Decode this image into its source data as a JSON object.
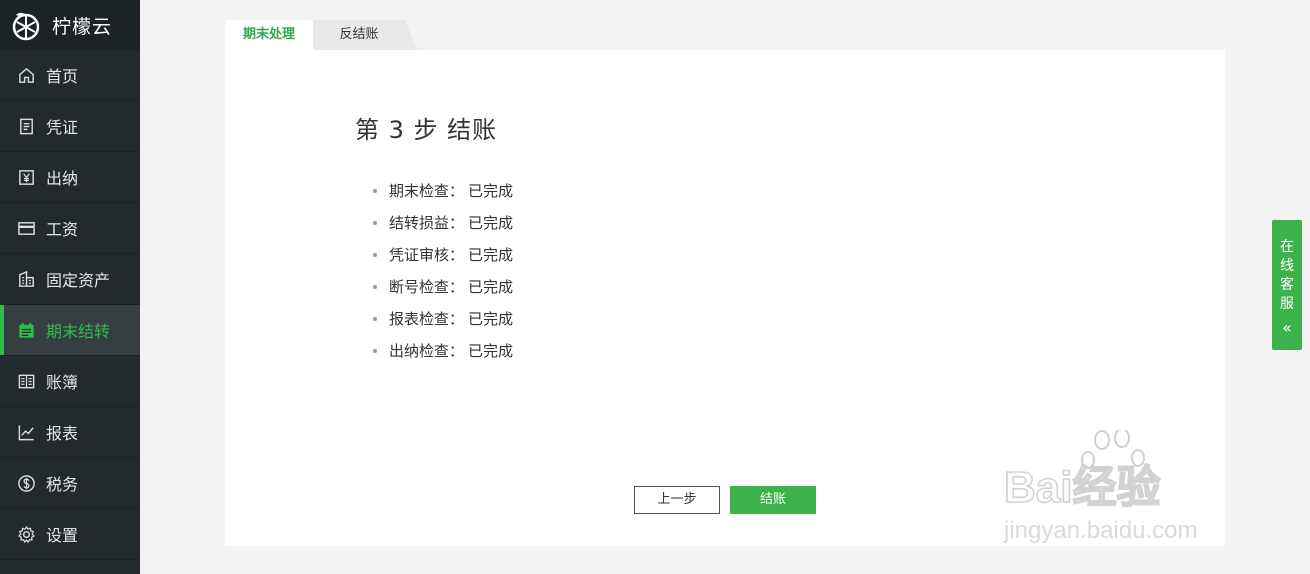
{
  "brand": {
    "name": "柠檬云",
    "logo": "lemon-slice-logo"
  },
  "sidebar": {
    "items": [
      {
        "label": "首页",
        "icon": "home-icon"
      },
      {
        "label": "凭证",
        "icon": "document-icon"
      },
      {
        "label": "出纳",
        "icon": "yen-icon"
      },
      {
        "label": "工资",
        "icon": "card-icon"
      },
      {
        "label": "固定资产",
        "icon": "building-icon"
      },
      {
        "label": "期末结转",
        "icon": "calendar-icon",
        "active": true
      },
      {
        "label": "账簿",
        "icon": "book-icon"
      },
      {
        "label": "报表",
        "icon": "chart-icon"
      },
      {
        "label": "税务",
        "icon": "dollar-icon"
      },
      {
        "label": "设置",
        "icon": "gear-icon"
      }
    ]
  },
  "tabs": [
    {
      "label": "期末处理",
      "active": true
    },
    {
      "label": "反结账",
      "active": false
    }
  ],
  "main": {
    "step_title": "第 3 步 结账",
    "checks": [
      {
        "label": "期末检查：",
        "status": "已完成"
      },
      {
        "label": "结转损益：",
        "status": "已完成"
      },
      {
        "label": "凭证审核：",
        "status": "已完成"
      },
      {
        "label": "断号检查：",
        "status": "已完成"
      },
      {
        "label": "报表检查：",
        "status": "已完成"
      },
      {
        "label": "出纳检查：",
        "status": "已完成"
      }
    ],
    "prev_button": "上一步",
    "close_button": "结账"
  },
  "customer_service": {
    "label": "在线客服",
    "arrow": "«"
  },
  "watermark": {
    "text": "Bai经验",
    "url": "jingyan.baidu.com"
  },
  "colors": {
    "accent": "#2fbd4b",
    "sidebar_bg": "#222a2e",
    "button_green": "#3db24a"
  }
}
